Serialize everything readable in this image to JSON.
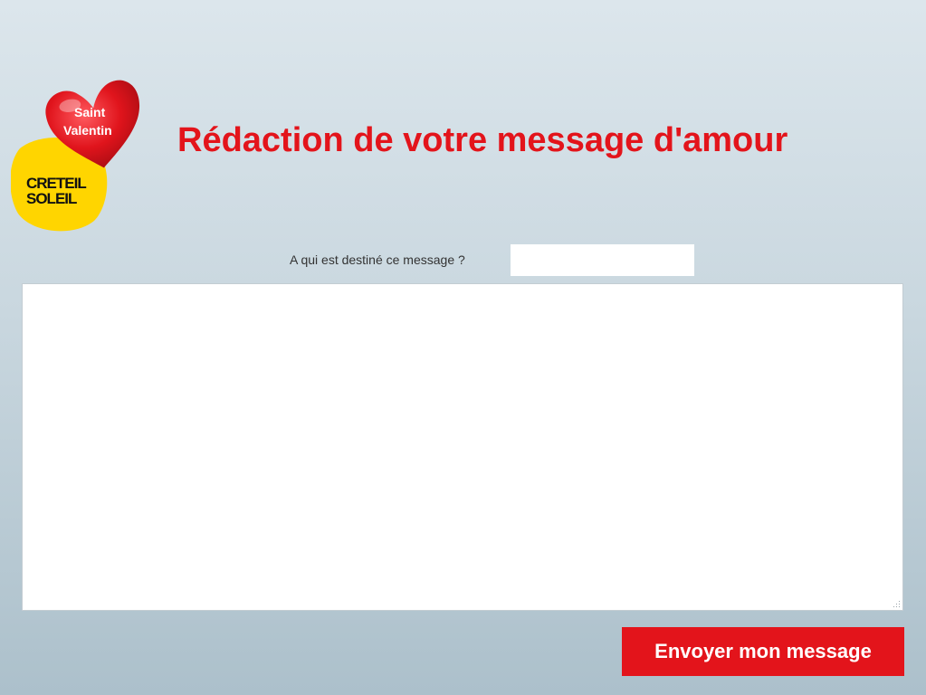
{
  "logo": {
    "heart_text_line1": "Saint",
    "heart_text_line2": "Valentin",
    "sun_text_line1": "CRETEIL",
    "sun_text_line2": "SOLEIL"
  },
  "page_title": "Rédaction de votre message d'amour",
  "form": {
    "recipient_label": "A qui est destiné ce message ?",
    "recipient_value": "",
    "message_value": "",
    "submit_label": "Envoyer mon message"
  },
  "colors": {
    "accent": "#e3141b",
    "sun": "#ffd500",
    "heart": "#dd1520"
  }
}
